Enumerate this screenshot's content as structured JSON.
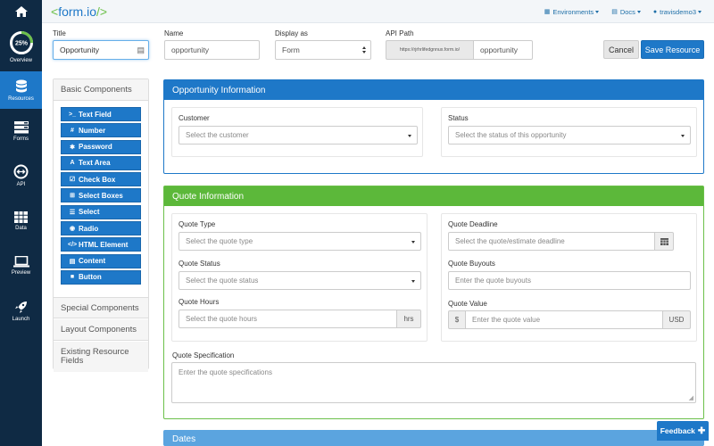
{
  "brand": {
    "text": "form.io",
    "accent": "#1e78c8",
    "green": "#6cc04a"
  },
  "nav": {
    "home_icon": "home-icon",
    "overview": {
      "label": "Overview",
      "progress": 25,
      "progress_text": "25%"
    },
    "items": [
      {
        "label": "Resources",
        "icon": "database-icon"
      },
      {
        "label": "Forms",
        "icon": "forms-icon"
      },
      {
        "label": "API",
        "icon": "api-icon"
      },
      {
        "label": "Data",
        "icon": "grid-icon"
      },
      {
        "label": "Preview",
        "icon": "laptop-icon"
      },
      {
        "label": "Launch",
        "icon": "rocket-icon"
      }
    ]
  },
  "topmenu": {
    "environments": "Environments",
    "docs": "Docs",
    "user": "travisdemo3"
  },
  "header": {
    "title_label": "Title",
    "title_value": "Opportunity",
    "name_label": "Name",
    "name_value": "opportunity",
    "display_label": "Display as",
    "display_value": "Form",
    "api_label": "API Path",
    "api_prefix": "https://rjrhrlifedgnnux.form.io/",
    "api_value": "opportunity",
    "cancel": "Cancel",
    "save": "Save Resource"
  },
  "builder": {
    "basic": "Basic Components",
    "components": [
      {
        "icon": ">_",
        "label": "Text Field"
      },
      {
        "icon": "#",
        "label": "Number"
      },
      {
        "icon": "✱",
        "label": "Password"
      },
      {
        "icon": "A",
        "label": "Text Area"
      },
      {
        "icon": "☑",
        "label": "Check Box"
      },
      {
        "icon": "⊞",
        "label": "Select Boxes"
      },
      {
        "icon": "☰",
        "label": "Select"
      },
      {
        "icon": "◉",
        "label": "Radio"
      },
      {
        "icon": "</>",
        "label": "HTML Element"
      },
      {
        "icon": "▤",
        "label": "Content"
      },
      {
        "icon": "■",
        "label": "Button"
      }
    ],
    "special": "Special Components",
    "layout": "Layout Components",
    "existing": "Existing Resource Fields"
  },
  "panel_opportunity": {
    "title": "Opportunity Information",
    "customer_label": "Customer",
    "customer_placeholder": "Select the customer",
    "status_label": "Status",
    "status_placeholder": "Select the status of this opportunity"
  },
  "panel_quote": {
    "title": "Quote Information",
    "type_label": "Quote Type",
    "type_placeholder": "Select the quote type",
    "status_label": "Quote Status",
    "status_placeholder": "Select the quote status",
    "hours_label": "Quote Hours",
    "hours_placeholder": "Select the quote hours",
    "hours_suffix": "hrs",
    "deadline_label": "Quote Deadline",
    "deadline_placeholder": "Select the quote/estimate deadline",
    "buyouts_label": "Quote Buyouts",
    "buyouts_placeholder": "Enter the quote buyouts",
    "value_label": "Quote Value",
    "value_prefix": "$",
    "value_placeholder": "Enter the quote value",
    "value_suffix": "USD",
    "spec_label": "Quote Specification",
    "spec_placeholder": "Enter the quote specifications"
  },
  "panel_dates": {
    "title": "Dates"
  },
  "feedback": {
    "label": "Feedback",
    "icon": "plus-icon"
  }
}
